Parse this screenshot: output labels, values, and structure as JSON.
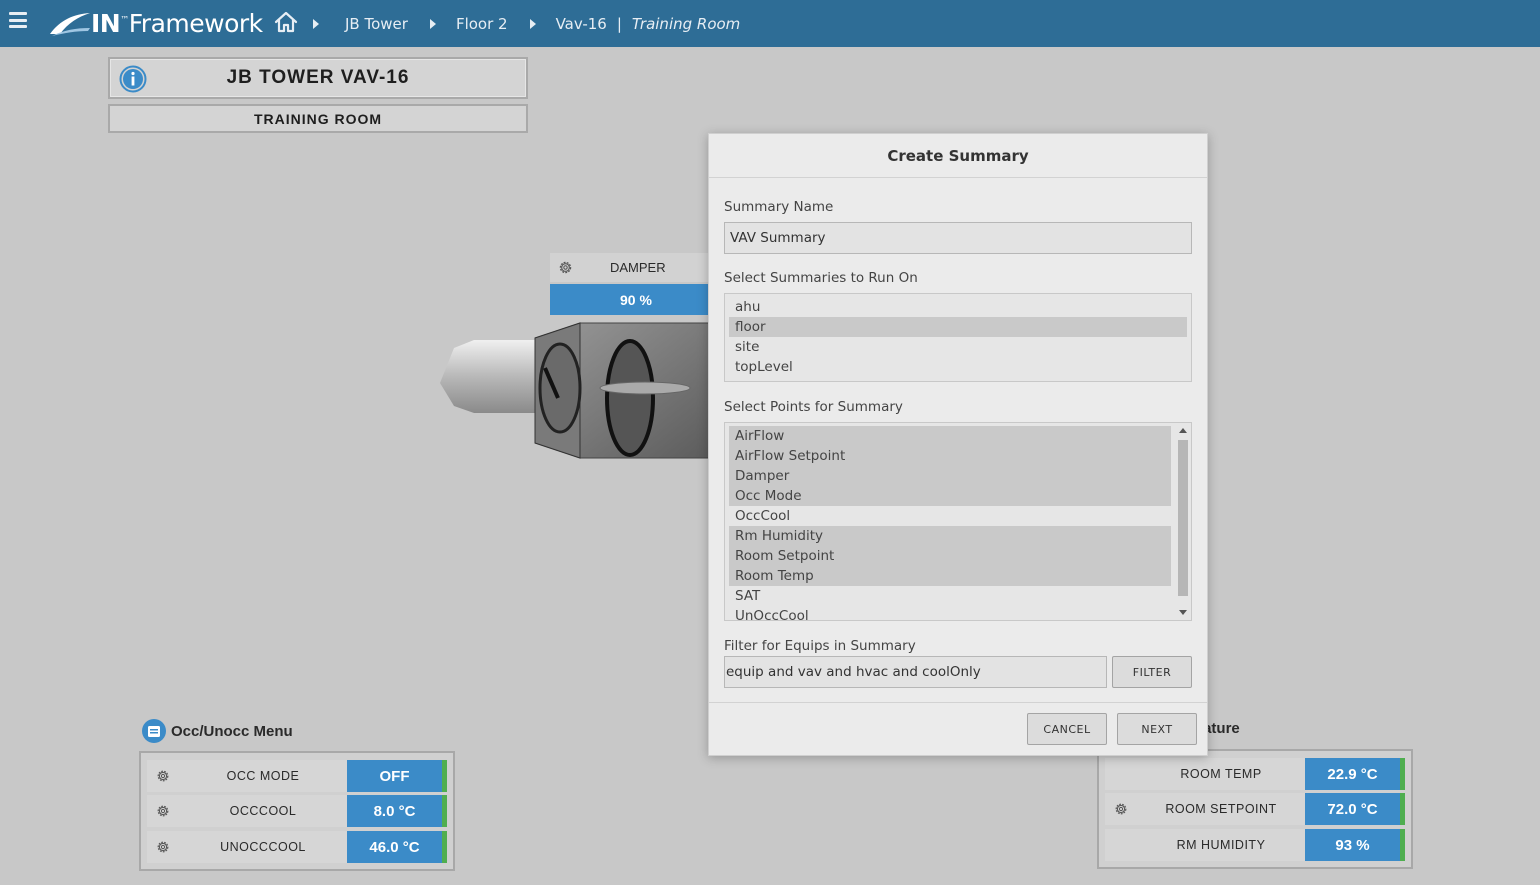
{
  "header": {
    "logo_in": "IN",
    "logo_tm": "™",
    "logo_framework": "Framework",
    "breadcrumbs": [
      "JB Tower",
      "Floor 2",
      "Vav-16"
    ],
    "separator": "|",
    "current": "Training Room"
  },
  "equip": {
    "title": "JB TOWER VAV-16",
    "subtitle": "TRAINING ROOM"
  },
  "damper": {
    "label": "DAMPER",
    "value": "90 %"
  },
  "occ_panel": {
    "title": "Occ/Unocc Menu",
    "rows": [
      {
        "label": "OCC MODE",
        "value": "OFF"
      },
      {
        "label": "OCCCOOL",
        "value": "8.0 °C"
      },
      {
        "label": "UNOCCCOOL",
        "value": "46.0 °C"
      }
    ]
  },
  "temp_panel": {
    "title": "Temperature",
    "rows": [
      {
        "label": "ROOM TEMP",
        "value": "22.9 °C"
      },
      {
        "label": "ROOM SETPOINT",
        "value": "72.0 °C"
      },
      {
        "label": "RM HUMIDITY",
        "value": "93 %"
      }
    ]
  },
  "modal": {
    "title": "Create Summary",
    "summary_name_label": "Summary Name",
    "summary_name_value": "VAV Summary",
    "run_on_label": "Select Summaries to Run On",
    "run_on_options": [
      "ahu",
      "floor",
      "site",
      "topLevel"
    ],
    "run_on_selected": [
      false,
      true,
      false,
      false
    ],
    "points_label": "Select Points for Summary",
    "points_options": [
      "AirFlow",
      "AirFlow Setpoint",
      "Damper",
      "Occ Mode",
      "OccCool",
      "Rm Humidity",
      "Room Setpoint",
      "Room Temp",
      "SAT",
      "UnOccCool"
    ],
    "points_selected": [
      true,
      true,
      true,
      true,
      false,
      true,
      true,
      true,
      false,
      false
    ],
    "filter_label": "Filter for Equips in Summary",
    "filter_value": "equip and vav and hvac and coolOnly",
    "filter_button": "FILTER",
    "cancel_button": "CANCEL",
    "next_button": "NEXT"
  },
  "colors": {
    "topbar": "#2e6d96",
    "value_blue": "#3b8bc8",
    "status_green": "#4fae4f",
    "background": "#c8c8c8"
  }
}
